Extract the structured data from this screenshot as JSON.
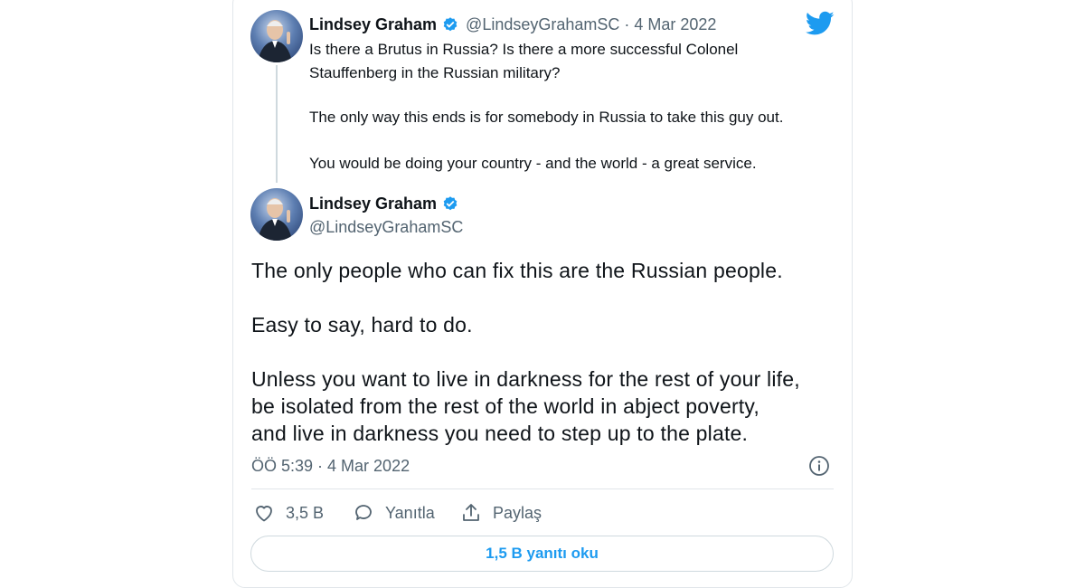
{
  "quoted_tweet": {
    "author_name": "Lindsey Graham",
    "handle": "@LindseyGrahamSC",
    "date": "4 Mar 2022",
    "separator": "·",
    "lines": [
      "Is there a Brutus in Russia?  Is there a more successful Colonel",
      "Stauffenberg in the Russian military?",
      "The only way this ends is for somebody in Russia to take this guy out.",
      "You would be doing your country - and the world - a great service."
    ]
  },
  "main_tweet": {
    "author_name": "Lindsey Graham",
    "handle": "@LindseyGrahamSC",
    "lines": [
      "The only people who can fix this are the Russian people.",
      "Easy to say, hard to do.",
      "Unless you want to live in darkness for the rest of your life,",
      "be isolated from the rest of the world in abject poverty,",
      "and live in darkness you need to step up to the plate."
    ],
    "timestamp": "ÖÖ 5:39 · 4 Mar 2022"
  },
  "actions": {
    "like_count": "3,5 B",
    "reply_label": "Yanıtla",
    "share_label": "Paylaş"
  },
  "read_replies_label": "1,5 B yanıtı oku",
  "colors": {
    "accent": "#1d9bf0",
    "text": "#0f1419",
    "secondary": "#536471",
    "border": "#e1e6ea"
  },
  "icons": [
    "twitter-bird-icon",
    "verified-badge-icon",
    "info-icon",
    "heart-icon",
    "comment-icon",
    "share-icon"
  ]
}
